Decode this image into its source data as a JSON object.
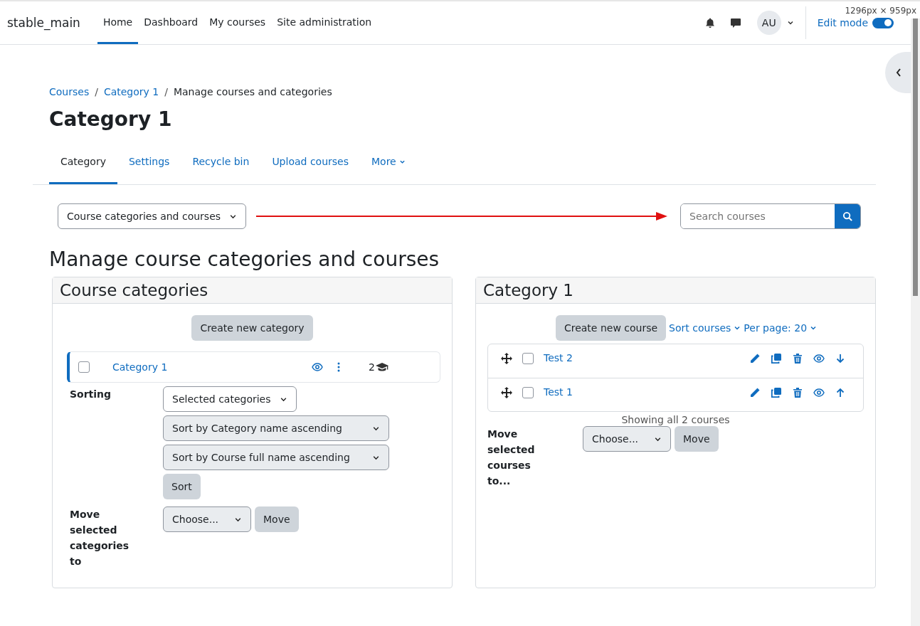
{
  "navbar": {
    "site_name": "stable_main",
    "links": [
      {
        "label": "Home",
        "selected": true
      },
      {
        "label": "Dashboard",
        "selected": false
      },
      {
        "label": "My courses",
        "selected": false
      },
      {
        "label": "Site administration",
        "selected": false
      }
    ],
    "avatar_initials": "AU",
    "edit_mode": {
      "label": "Edit mode",
      "on": true
    }
  },
  "size_label": "1296px × 959px",
  "breadcrumb": [
    {
      "label": "Courses",
      "link": true
    },
    {
      "separator_before": "/",
      "label": "Category 1",
      "link": true
    },
    {
      "separator_before": "/",
      "label": "Manage courses and categories",
      "link": false
    }
  ],
  "page_title": "Category 1",
  "tabs": [
    {
      "label": "Category",
      "selected": true
    },
    {
      "label": "Settings",
      "selected": false
    },
    {
      "label": "Recycle bin",
      "selected": false
    },
    {
      "label": "Upload courses",
      "selected": false
    },
    {
      "label": "More",
      "selected": false
    }
  ],
  "view_select": "Course categories and courses",
  "search": {
    "placeholder": "Search courses"
  },
  "heading": "Manage course categories and courses",
  "categories_panel": {
    "title": "Course categories",
    "create_button": "Create new category",
    "categories": [
      {
        "name": "Category 1",
        "selected": true,
        "checked": false,
        "course_count": "2"
      }
    ],
    "sorting_label": "Sorting",
    "sort_scope": "Selected categories",
    "sort_category": "Sort by Category name ascending",
    "sort_course": "Sort by Course full name ascending",
    "sort_button": "Sort",
    "move_label": "Move selected categories to",
    "move_select": "Choose...",
    "move_button": "Move"
  },
  "courses_panel": {
    "title": "Category 1",
    "create_button": "Create new course",
    "sort_link": "Sort courses",
    "per_page_link": "Per page: 20",
    "courses": [
      {
        "name": "Test 2",
        "checked": false,
        "kind": "down"
      },
      {
        "name": "Test 1",
        "checked": false,
        "kind": "up"
      }
    ],
    "summary": "Showing all 2 courses",
    "move_label": "Move selected courses to...",
    "move_select": "Choose...",
    "move_button": "Move"
  }
}
